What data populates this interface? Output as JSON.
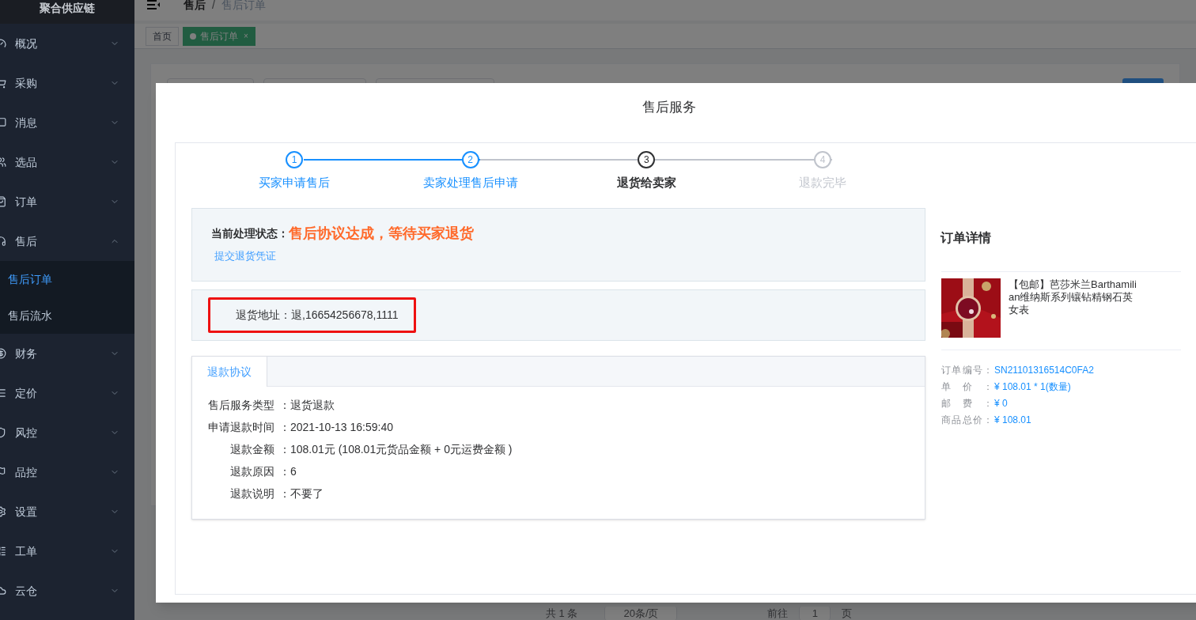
{
  "sidebar": {
    "title": "聚合供应链",
    "items": [
      {
        "label": "概况",
        "expanded": false
      },
      {
        "label": "采购",
        "expanded": false
      },
      {
        "label": "消息",
        "expanded": false
      },
      {
        "label": "选品",
        "expanded": false
      },
      {
        "label": "订单",
        "expanded": false
      },
      {
        "label": "售后",
        "expanded": true,
        "children": [
          {
            "label": "售后订单",
            "selected": true
          },
          {
            "label": "售后流水",
            "selected": false
          }
        ]
      },
      {
        "label": "财务",
        "expanded": false
      },
      {
        "label": "定价",
        "expanded": false
      },
      {
        "label": "风控",
        "expanded": false
      },
      {
        "label": "品控",
        "expanded": false
      },
      {
        "label": "设置",
        "expanded": false
      },
      {
        "label": "工单",
        "expanded": false
      },
      {
        "label": "云仓",
        "expanded": false
      }
    ]
  },
  "header": {
    "breadcrumb": [
      "售后",
      "售后订单"
    ],
    "separator": "/"
  },
  "tabs": [
    {
      "label": "首页",
      "selected": false
    },
    {
      "label": "售后订单",
      "selected": true,
      "close": "×"
    }
  ],
  "pagination": {
    "total": "共 1 条",
    "page_size": "20条/页",
    "goto": "前往",
    "page": "1",
    "unit": "页"
  },
  "modal": {
    "title": "售后服务",
    "steps": [
      {
        "number": "1",
        "label": "买家申请售后",
        "done": true,
        "current": false
      },
      {
        "number": "2",
        "label": "卖家处理售后申请",
        "done": true,
        "current": false
      },
      {
        "number": "3",
        "label": "退货给卖家",
        "done": false,
        "current": true
      },
      {
        "number": "4",
        "label": "退款完毕",
        "done": false,
        "current": false
      }
    ],
    "status_panel": {
      "label": "当前处理状态：",
      "value": "售后协议达成，等待买家退货",
      "link": "提交退货凭证"
    },
    "address": {
      "text": "退货地址：退,16654256678,1111",
      "highlighted": true
    },
    "agreement": {
      "tabs": [
        {
          "label": "退款协议",
          "selected": true
        }
      ],
      "rows": [
        {
          "label": "售后服务类型",
          "value": "：退货退款"
        },
        {
          "label": "申请退款时间",
          "value": "：2021-10-13 16:59:40"
        },
        {
          "label": "退款金额",
          "value": "：108.01元 (108.01元货品金额 + 0元运费金额 )"
        },
        {
          "label": "退款原因",
          "value": "：6"
        },
        {
          "label": "退款说明",
          "value": "：不要了"
        }
      ]
    },
    "order": {
      "title": "订单详情",
      "product": {
        "name": "【包邮】芭莎米兰Barthamilian维纳斯系列镶钻精钢石英女表"
      },
      "fields": [
        {
          "label": "订单编号：",
          "value": "SN21101316514C0FA2"
        },
        {
          "label": "单价：",
          "value": "¥ 108.01 * 1(数量)"
        },
        {
          "label": "邮费：",
          "value": "¥ 0"
        },
        {
          "label": "商品总价：",
          "value": "¥ 108.01"
        }
      ]
    }
  }
}
